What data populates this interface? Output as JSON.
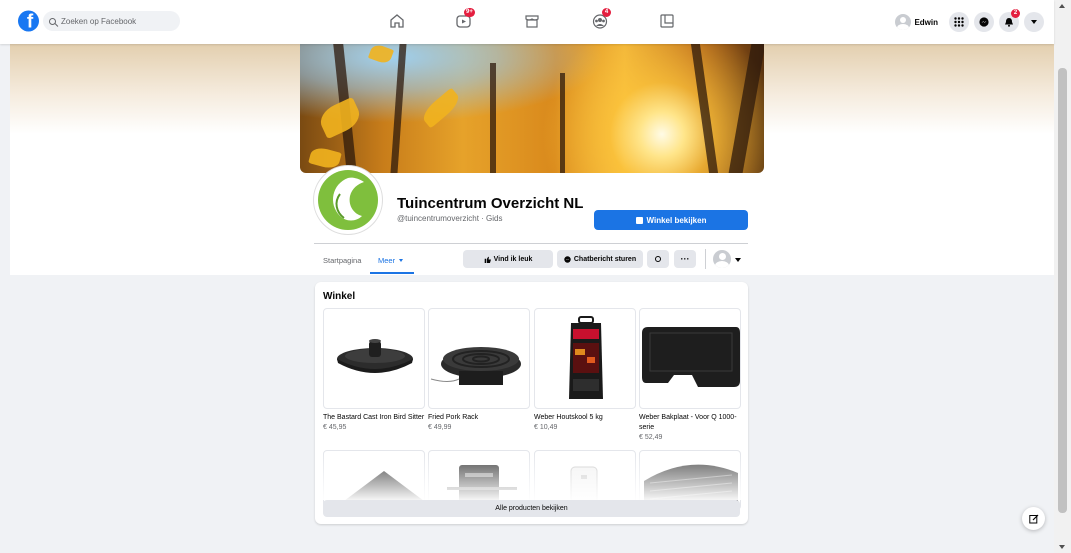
{
  "topbar": {
    "search_placeholder": "Zoeken op Facebook",
    "watch_badge": "9+",
    "groups_badge": "4",
    "profile_name": "Edwin",
    "notifications_badge": "2"
  },
  "page": {
    "title": "Tuincentrum Overzicht NL",
    "subtitle": "@tuincentrumoverzicht · Gids",
    "shop_button": "Winkel bekijken"
  },
  "tabs": {
    "home": "Startpagina",
    "more": "Meer"
  },
  "actions": {
    "like": "Vind ik leuk",
    "message": "Chatbericht sturen"
  },
  "shop": {
    "title": "Winkel",
    "all_products": "Alle producten bekijken",
    "products": [
      {
        "name": "The Bastard Cast Iron Bird Sitter",
        "price": "€ 45,95"
      },
      {
        "name": "Fried Pork Rack",
        "price": "€ 49,99"
      },
      {
        "name": "Weber Houtskool 5 kg",
        "price": "€ 10,49"
      },
      {
        "name": "Weber Bakplaat - Voor Q 1000- serie",
        "price": "€ 52,49"
      }
    ]
  },
  "colors": {
    "brand": "#1877f2",
    "button_blue": "#1b74e4",
    "badge_red": "#e41e3f"
  }
}
